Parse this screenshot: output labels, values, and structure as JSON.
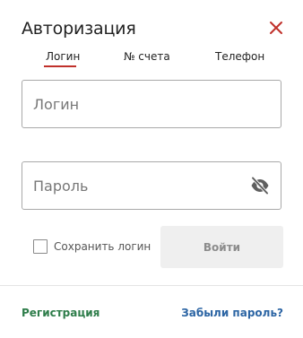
{
  "dialog": {
    "title": "Авторизация",
    "close_icon": "close-icon",
    "accent_color": "#c0312b"
  },
  "tabs": [
    {
      "label": "Логин",
      "active": true
    },
    {
      "label": "№ счета",
      "active": false
    },
    {
      "label": "Телефон",
      "active": false
    }
  ],
  "form": {
    "login": {
      "placeholder": "Логин",
      "value": ""
    },
    "password": {
      "placeholder": "Пароль",
      "value": "",
      "toggle_icon": "eye-slash-icon"
    },
    "remember": {
      "label": "Сохранить логин",
      "checked": false
    },
    "submit_label": "Войти"
  },
  "footer": {
    "register_label": "Регистрация",
    "register_color": "#2e7d4a",
    "forgot_label": "Забыли пароль?",
    "forgot_color": "#2c65a4"
  }
}
